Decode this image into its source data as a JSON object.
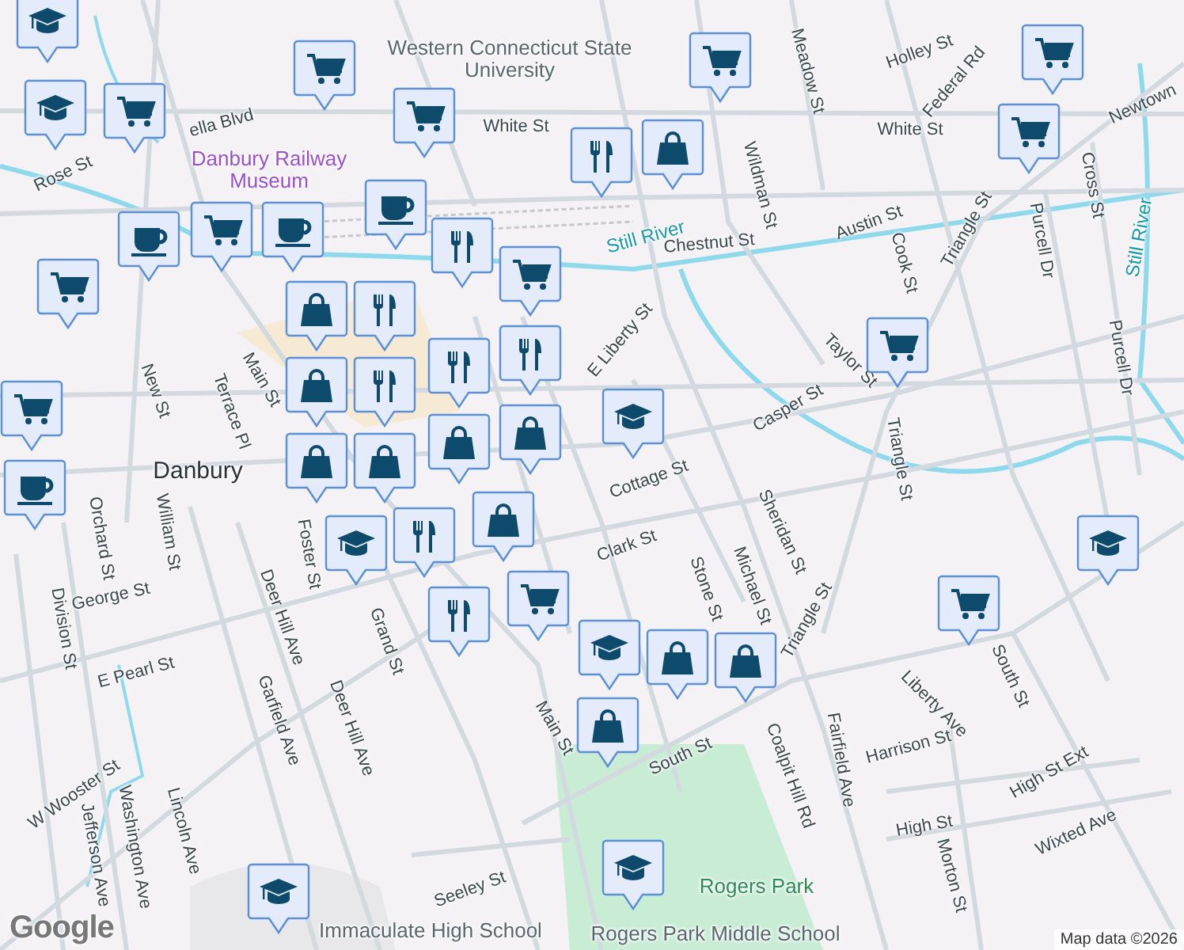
{
  "labels": [
    {
      "text": "Western Connecticut State University",
      "kind": "poi"
    },
    {
      "text": "Danbury Railway Museum",
      "kind": "museum"
    },
    {
      "text": "White St",
      "kind": "street"
    },
    {
      "text": "White St",
      "kind": "street"
    },
    {
      "text": "Federal Rd",
      "kind": "street"
    },
    {
      "text": "Newtown",
      "kind": "street"
    },
    {
      "text": "Rose St",
      "kind": "street"
    },
    {
      "text": "ella Blvd",
      "kind": "street"
    },
    {
      "text": "Still River",
      "kind": "water"
    },
    {
      "text": "Still River",
      "kind": "water"
    },
    {
      "text": "Chestnut St",
      "kind": "street"
    },
    {
      "text": "Austin St",
      "kind": "street"
    },
    {
      "text": "Wildman St",
      "kind": "street"
    },
    {
      "text": "Meadow St",
      "kind": "street"
    },
    {
      "text": "Holley St",
      "kind": "street"
    },
    {
      "text": "Cook St",
      "kind": "street"
    },
    {
      "text": "Triangle St",
      "kind": "street"
    },
    {
      "text": "Purcell Dr",
      "kind": "street"
    },
    {
      "text": "Purcell Dr",
      "kind": "street"
    },
    {
      "text": "Cross St",
      "kind": "street"
    },
    {
      "text": "Taylor St",
      "kind": "street"
    },
    {
      "text": "Casper St",
      "kind": "street"
    },
    {
      "text": "Triangle St",
      "kind": "street"
    },
    {
      "text": "E Liberty St",
      "kind": "street"
    },
    {
      "text": "Cottage St",
      "kind": "street"
    },
    {
      "text": "Clark St",
      "kind": "street"
    },
    {
      "text": "Sheridan St",
      "kind": "street"
    },
    {
      "text": "Michael St",
      "kind": "street"
    },
    {
      "text": "Stone St",
      "kind": "street"
    },
    {
      "text": "Triangle St",
      "kind": "street"
    },
    {
      "text": "South St",
      "kind": "street"
    },
    {
      "text": "South St",
      "kind": "street"
    },
    {
      "text": "Coalpit Hill Rd",
      "kind": "street"
    },
    {
      "text": "Fairfield Ave",
      "kind": "street"
    },
    {
      "text": "Liberty Ave",
      "kind": "street"
    },
    {
      "text": "Harrison St",
      "kind": "street"
    },
    {
      "text": "High St Ext",
      "kind": "street"
    },
    {
      "text": "High St",
      "kind": "street"
    },
    {
      "text": "Wixted Ave",
      "kind": "street"
    },
    {
      "text": "Morton St",
      "kind": "street"
    },
    {
      "text": "Main St",
      "kind": "street"
    },
    {
      "text": "Main St",
      "kind": "street"
    },
    {
      "text": "Grand St",
      "kind": "street"
    },
    {
      "text": "Deer Hill Ave",
      "kind": "street"
    },
    {
      "text": "Deer Hill Ave",
      "kind": "street"
    },
    {
      "text": "Garfield Ave",
      "kind": "street"
    },
    {
      "text": "Foster St",
      "kind": "street"
    },
    {
      "text": "Terrace Pl",
      "kind": "street"
    },
    {
      "text": "New St",
      "kind": "street"
    },
    {
      "text": "Danbury",
      "kind": "town"
    },
    {
      "text": "Orchard St",
      "kind": "street"
    },
    {
      "text": "William St",
      "kind": "street"
    },
    {
      "text": "George St",
      "kind": "street"
    },
    {
      "text": "Division St",
      "kind": "street"
    },
    {
      "text": "E Pearl St",
      "kind": "street"
    },
    {
      "text": "W Wooster St",
      "kind": "street"
    },
    {
      "text": "Washington Ave",
      "kind": "street"
    },
    {
      "text": "Lincoln Ave",
      "kind": "street"
    },
    {
      "text": "Jefferson Ave",
      "kind": "street"
    },
    {
      "text": "Seeley St",
      "kind": "street"
    },
    {
      "text": "Immaculate High School",
      "kind": "poi"
    },
    {
      "text": "Rogers Park",
      "kind": "park"
    },
    {
      "text": "Rogers Park Middle School",
      "kind": "poi"
    }
  ],
  "markers": [
    {
      "kind": "school"
    },
    {
      "kind": "school"
    },
    {
      "kind": "store"
    },
    {
      "kind": "store"
    },
    {
      "kind": "cafe"
    },
    {
      "kind": "store"
    },
    {
      "kind": "store"
    },
    {
      "kind": "store"
    },
    {
      "kind": "store"
    },
    {
      "kind": "restaurant"
    },
    {
      "kind": "shop"
    },
    {
      "kind": "cafe"
    },
    {
      "kind": "store"
    },
    {
      "kind": "cafe"
    },
    {
      "kind": "store"
    },
    {
      "kind": "shop"
    },
    {
      "kind": "restaurant"
    },
    {
      "kind": "shop"
    },
    {
      "kind": "restaurant"
    },
    {
      "kind": "restaurant"
    },
    {
      "kind": "restaurant"
    },
    {
      "kind": "store"
    },
    {
      "kind": "restaurant"
    },
    {
      "kind": "shop"
    },
    {
      "kind": "shop"
    },
    {
      "kind": "shop"
    },
    {
      "kind": "shop"
    },
    {
      "kind": "restaurant"
    },
    {
      "kind": "school"
    },
    {
      "kind": "school"
    },
    {
      "kind": "store"
    },
    {
      "kind": "cafe"
    },
    {
      "kind": "shop"
    },
    {
      "kind": "restaurant"
    },
    {
      "kind": "store"
    },
    {
      "kind": "school"
    },
    {
      "kind": "shop"
    },
    {
      "kind": "shop"
    },
    {
      "kind": "shop"
    },
    {
      "kind": "store"
    },
    {
      "kind": "school"
    },
    {
      "kind": "store"
    },
    {
      "kind": "school"
    },
    {
      "kind": "school"
    }
  ],
  "logo": "Google",
  "attribution": "Map data ©2026"
}
